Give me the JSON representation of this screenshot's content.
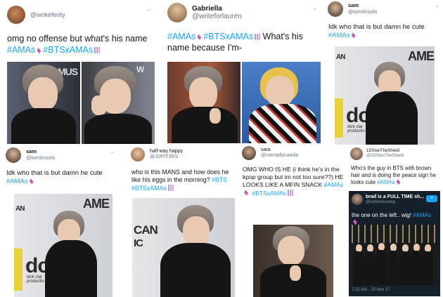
{
  "tweets": [
    {
      "display_name": "",
      "handle": "@wokefenty",
      "text_a": "omg no offense but what's his name",
      "tag1": "#AMAs",
      "tag2": "#BTSxAMAs"
    },
    {
      "display_name": "Gabriella",
      "handle": "@writeforlauren",
      "tag1": "#AMAs",
      "tag2": "#BTSxAMAs",
      "text_b": "What's his name because I'm-"
    },
    {
      "display_name": "sam",
      "handle": "@tomlinsolo",
      "text_a": "Idk who that is but damn he cute",
      "tag1": "#AMAs",
      "sign_text": "AME",
      "sign_text2": "AN",
      "sign_dc": "dc",
      "sign_dc_sub": "dick clar productio"
    },
    {
      "display_name": "sam",
      "handle": "@tomlinsolo",
      "text_a": "Idk who that is but damn he cute",
      "tag1": "#AMAs",
      "sign_text": "AME",
      "sign_text2": "AN",
      "sign_dc": "dc",
      "sign_dc_sub": "dick clar productio"
    },
    {
      "display_name": "half-way happy",
      "handle": "@JUPIT3RS",
      "text_a": "who is this MANS and how does he like his eggs in the morning?",
      "tag1": "#BTS",
      "tag2": "#BTSxAMAs",
      "sign_text": "CAN",
      "sign_text2": "IC"
    },
    {
      "display_name": "sara",
      "handle": "@mentallycamila",
      "text_a": "OMG WHO IS HE (i think he's in the kpop group but im not too sure??) HE LOOKS LIKE A MFIN SNACK",
      "tag1": "#AMAs",
      "tag2": "#BTSxAMAs"
    },
    {
      "display_name": "1DStanTheShield",
      "handle": "@1DStanTheShield",
      "text_a": "Who's the guy in BTS with brown hair and is doing the peace sign he looks cute",
      "tag1": "#AMAs",
      "embed": {
        "display_name": "brad is a FULL TIME sh...",
        "handle": "@karlasdusang",
        "text_a": "the one on the left.. wig!",
        "tag1": "#AMAs",
        "timestamp": "7:22 AM - 20 Nov 17"
      }
    }
  ],
  "colors": {
    "link": "#1da1f2",
    "text": "#14171a",
    "muted": "#657786"
  },
  "icons": {
    "more": "chevron-down-icon",
    "amas": "amas-hashflag-icon",
    "bts": "bts-hashflag-icon",
    "follow": "follow-icon"
  }
}
